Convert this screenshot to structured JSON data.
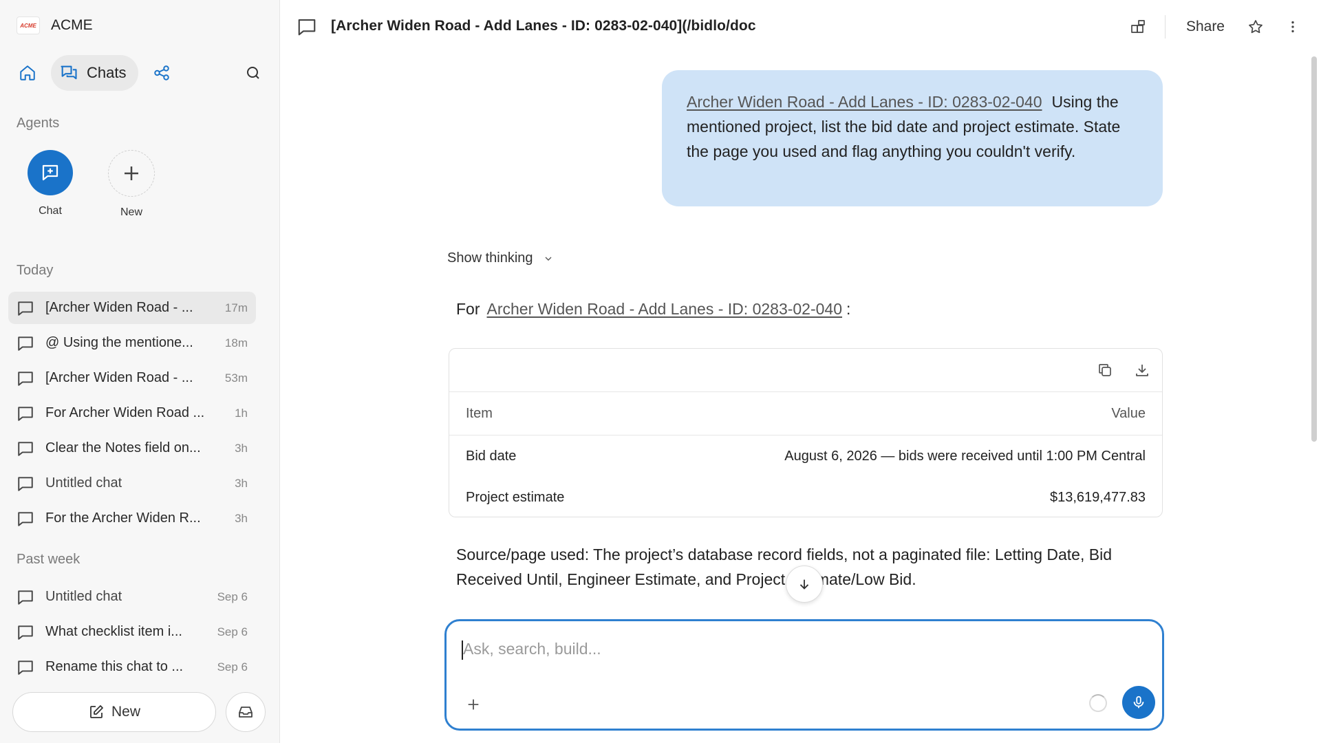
{
  "app": {
    "name": "ACME",
    "logo_text": "ACME"
  },
  "nav": {
    "chats_label": "Chats"
  },
  "sidebar": {
    "agents_label": "Agents",
    "agents": [
      {
        "label": "Chat",
        "icon": "chat-plus-icon"
      },
      {
        "label": "New",
        "icon": "plus-icon"
      }
    ],
    "today_label": "Today",
    "today": [
      {
        "title": "[Archer Widen Road - ...",
        "time": "17m",
        "active": true
      },
      {
        "title": "@ Using the mentione...",
        "time": "18m"
      },
      {
        "title": "[Archer Widen Road - ...",
        "time": "53m"
      },
      {
        "title": "For Archer Widen Road ...",
        "time": "1h"
      },
      {
        "title": "Clear the Notes field on...",
        "time": "3h"
      },
      {
        "title": "Untitled chat",
        "time": "3h"
      },
      {
        "title": "For the Archer Widen R...",
        "time": "3h"
      }
    ],
    "past_week_label": "Past week",
    "past_week": [
      {
        "title": "Untitled chat",
        "time": "Sep 6"
      },
      {
        "title": "What checklist item i...",
        "time": "Sep 6"
      },
      {
        "title": "Rename this chat to ...",
        "time": "Sep 6"
      }
    ],
    "new_button_label": "New"
  },
  "header": {
    "title": "[Archer Widen Road - Add Lanes - ID: 0283-02-040](/bidlo/doc",
    "share_label": "Share"
  },
  "conversation": {
    "user_message": {
      "mention": "Archer Widen Road - Add Lanes - ID: 0283-02-040",
      "text": "Using the mentioned project, list the bid date and project estimate. State the page you used and flag anything you couldn't verify."
    },
    "show_thinking_label": "Show thinking",
    "reply_prefix": "For",
    "reply_link": "Archer Widen Road - Add Lanes - ID: 0283-02-040",
    "reply_suffix": ":",
    "table": {
      "headers": [
        "Item",
        "Value"
      ],
      "rows": [
        [
          "Bid date",
          "August 6, 2026 — bids were received until 1:00 PM Central"
        ],
        [
          "Project estimate",
          "$13,619,477.83"
        ]
      ]
    },
    "source_text": "Source/page used: The project’s database record fields, not a paginated file: Letting Date, Bid Received Until, Engineer Estimate, and Project Estimate/Low Bid."
  },
  "composer": {
    "placeholder": "Ask, search, build..."
  },
  "colors": {
    "accent": "#1a73c9",
    "user_bubble": "#cfe3f7",
    "composer_border": "#2f80d0"
  }
}
